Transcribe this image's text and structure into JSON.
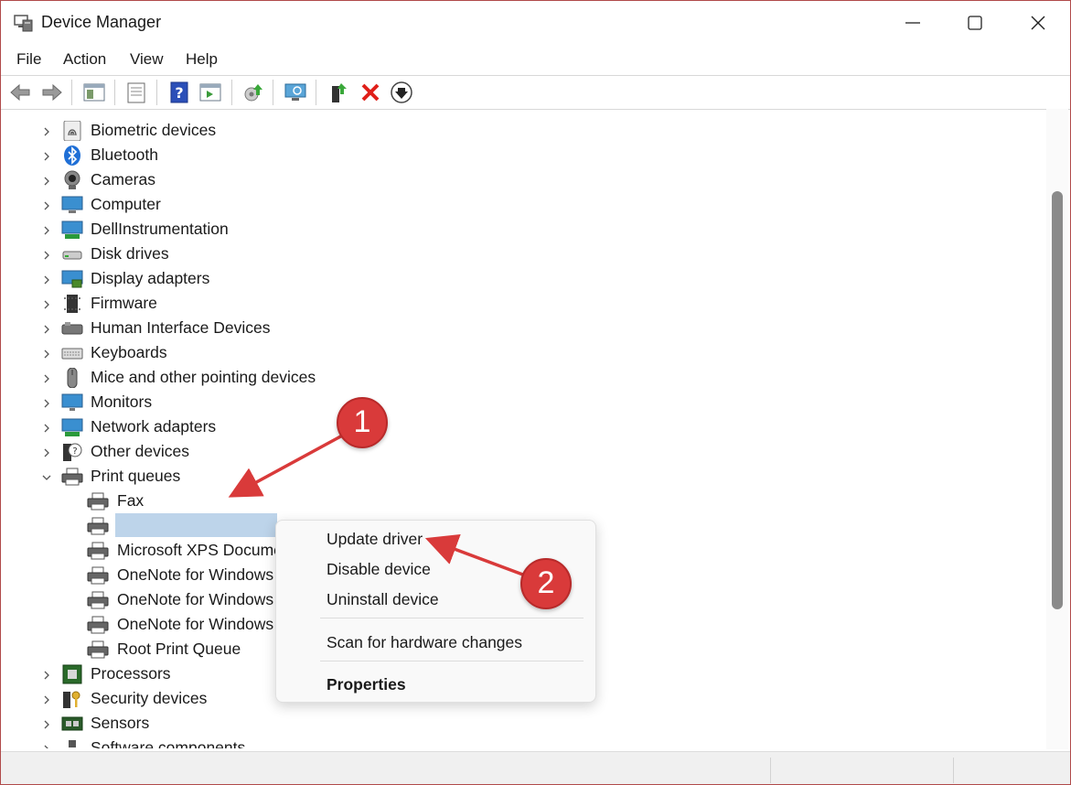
{
  "window": {
    "title": "Device Manager"
  },
  "menu": [
    "File",
    "Action",
    "View",
    "Help"
  ],
  "tree": {
    "top_before": [
      {
        "label": "Biometric devices",
        "icon": "fingerprint-icon"
      },
      {
        "label": "Bluetooth",
        "icon": "bluetooth-icon"
      },
      {
        "label": "Cameras",
        "icon": "camera-icon"
      },
      {
        "label": "Computer",
        "icon": "computer-icon"
      },
      {
        "label": "DellInstrumentation",
        "icon": "network-monitor-icon"
      },
      {
        "label": "Disk drives",
        "icon": "disk-drive-icon"
      },
      {
        "label": "Display adapters",
        "icon": "display-adapter-icon"
      },
      {
        "label": "Firmware",
        "icon": "chip-icon"
      },
      {
        "label": "Human Interface Devices",
        "icon": "hid-icon"
      },
      {
        "label": "Keyboards",
        "icon": "keyboard-icon"
      },
      {
        "label": "Mice and other pointing devices",
        "icon": "mouse-icon"
      },
      {
        "label": "Monitors",
        "icon": "monitor-icon"
      },
      {
        "label": "Network adapters",
        "icon": "network-adapter-icon"
      },
      {
        "label": "Other devices",
        "icon": "unknown-device-icon"
      },
      {
        "label": "Print queues",
        "icon": "printer-icon"
      }
    ],
    "print_children": [
      {
        "label": "Fax"
      },
      {
        "label": ""
      },
      {
        "label": "Microsoft XPS Docume"
      },
      {
        "label": "OneNote for Windows"
      },
      {
        "label": "OneNote for Windows"
      },
      {
        "label": "OneNote for Windows"
      },
      {
        "label": "Root Print Queue"
      }
    ],
    "top_after": [
      {
        "label": "Processors",
        "icon": "processor-icon"
      },
      {
        "label": "Security devices",
        "icon": "security-key-icon"
      },
      {
        "label": "Sensors",
        "icon": "sensor-icon"
      },
      {
        "label": "Software components",
        "icon": "software-component-icon"
      }
    ]
  },
  "context_menu": {
    "update": "Update driver",
    "disable": "Disable device",
    "uninstall": "Uninstall device",
    "scan": "Scan for hardware changes",
    "properties": "Properties"
  },
  "annotations": {
    "badge1": "1",
    "badge2": "2",
    "color": "#d93a3a"
  }
}
